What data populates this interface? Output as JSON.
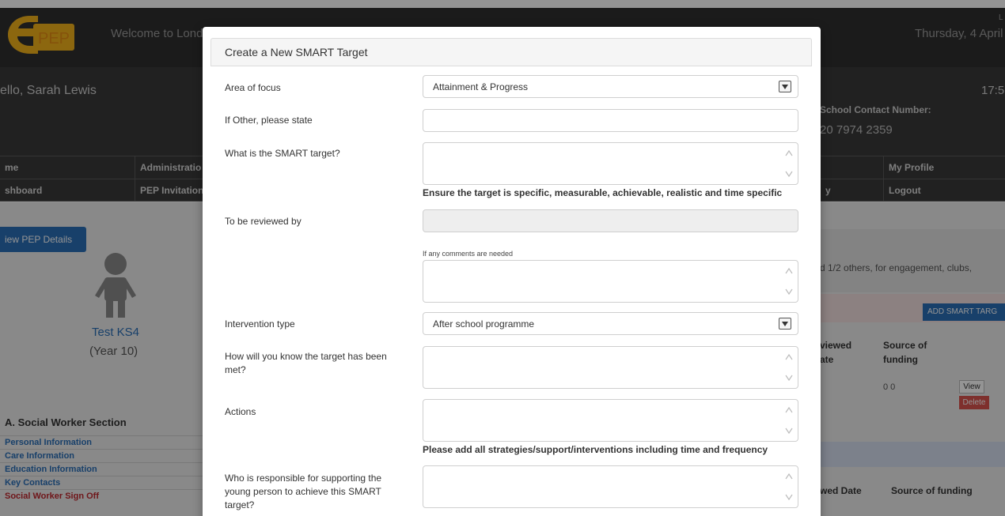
{
  "header": {
    "logo_text": "PEP",
    "welcome": "Welcome to Lond",
    "date": "Thursday, 4 April 2",
    "corner_letter": "L",
    "greeting": "ello, Sarah Lewis",
    "time": "17:5",
    "contact_label": "School Contact Number:",
    "contact_number": "20 7974 2359"
  },
  "nav": {
    "row1": [
      {
        "label": "me",
        "left": "0"
      },
      {
        "label": "Administratio"
      },
      {
        "label": "My Profile"
      }
    ],
    "row2": [
      {
        "label": "shboard"
      },
      {
        "label": "PEP Invitation"
      },
      {
        "label": "y"
      },
      {
        "label": "Logout"
      }
    ]
  },
  "left": {
    "view_pep_button": "iew PEP Details",
    "child_name": "Test KS4",
    "child_year": "(Year 10)",
    "section_title": "A. Social Worker Section",
    "section_links": [
      "Personal Information",
      "Care Information",
      "Education Information",
      "Key Contacts",
      "Social Worker Sign Off"
    ]
  },
  "right": {
    "others_text": "d 1/2 others, for engagement, clubs,",
    "add_smart_button": "ADD SMART TARG",
    "col_reviewed_1": "viewed",
    "col_reviewed_2": "ate",
    "col_source_1": "Source of",
    "col_source_2": "funding",
    "source_value": "0 0",
    "view_button": "View",
    "delete_button": "Delete",
    "col_reviewed_date": "wed Date",
    "col_source_funding": "Source of funding"
  },
  "modal": {
    "title": "Create a New SMART Target",
    "area_of_focus": {
      "label": "Area of focus",
      "value": "Attainment & Progress"
    },
    "if_other": {
      "label": "If Other, please state",
      "value": ""
    },
    "smart_target": {
      "label": "What is the SMART target?",
      "value": "",
      "hint": "Ensure the target is specific, measurable, achievable, realistic and time specific"
    },
    "reviewed_by": {
      "label": "To be reviewed by",
      "value": ""
    },
    "comments": {
      "hint": "If any comments are needed",
      "value": ""
    },
    "intervention_type": {
      "label": "Intervention type",
      "value": "After school programme"
    },
    "target_met": {
      "label": "How will you know the target has been met?",
      "value": ""
    },
    "actions": {
      "label": "Actions",
      "value": "",
      "hint": "Please add all strategies/support/interventions including time and frequency"
    },
    "responsible": {
      "label": "Who is responsible for supporting the young person to achieve this SMART target?",
      "value": ""
    }
  },
  "colors": {
    "header_dark": "#2f2f2f",
    "link_blue": "#2a6eb7",
    "danger_red": "#c0272d",
    "logo_yellow": "#f2b21b"
  }
}
